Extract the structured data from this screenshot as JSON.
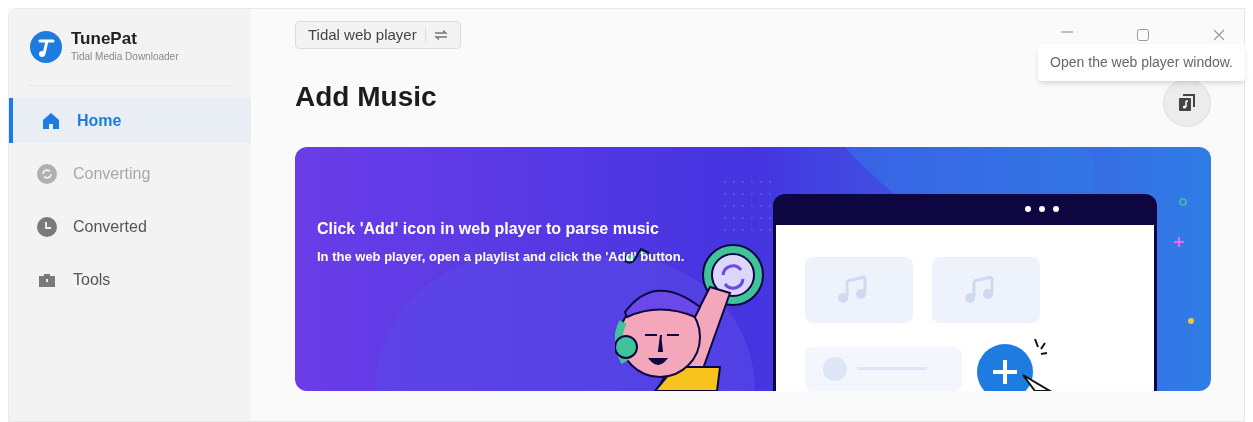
{
  "app": {
    "name": "TunePat",
    "subtitle": "Tidal Media Downloader"
  },
  "sidebar": {
    "items": [
      {
        "label": "Home",
        "kind": "home",
        "selected": true,
        "disabled": false
      },
      {
        "label": "Converting",
        "kind": "converting",
        "selected": false,
        "disabled": true
      },
      {
        "label": "Converted",
        "kind": "clock",
        "selected": false,
        "disabled": false
      },
      {
        "label": "Tools",
        "kind": "toolbox",
        "selected": false,
        "disabled": false
      }
    ]
  },
  "source_switch": {
    "label": "Tidal web player"
  },
  "title": "Add Music",
  "tooltip": "Open the web player window.",
  "banner": {
    "heading": "Click 'Add' icon in web player to parse music",
    "text": "In the web player, open a playlist and click the 'Add' button."
  }
}
